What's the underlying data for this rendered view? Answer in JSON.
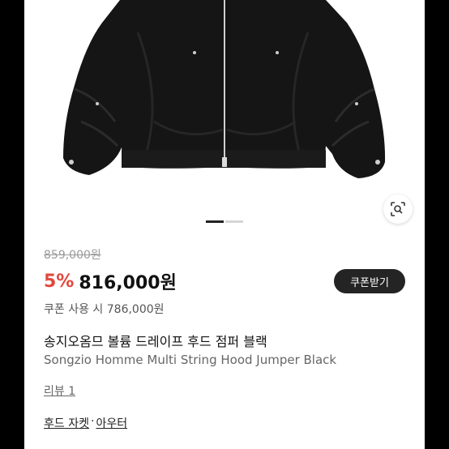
{
  "product": {
    "original_price": "859,000원",
    "discount_rate": "5%",
    "sale_price": "816,000원",
    "coupon_button": "쿠폰받기",
    "coupon_price_text": "쿠폰 사용 시 786,000원",
    "name_ko": "송지오옴므 볼륨 드레이프 후드 점퍼 블랙",
    "name_en": "Songzio Homme Multi String Hood Jumper Black",
    "review_link": "리뷰 1",
    "category": {
      "primary": "후드 자켓",
      "separator": "·",
      "secondary": "아우터"
    }
  },
  "carousel": {
    "total": 2,
    "active": 1
  },
  "colors": {
    "discount": "#e2483d",
    "coupon_button_bg": "#242424",
    "jacket": "#141414"
  },
  "icons": {
    "lens": "camera-lens-search-icon"
  }
}
